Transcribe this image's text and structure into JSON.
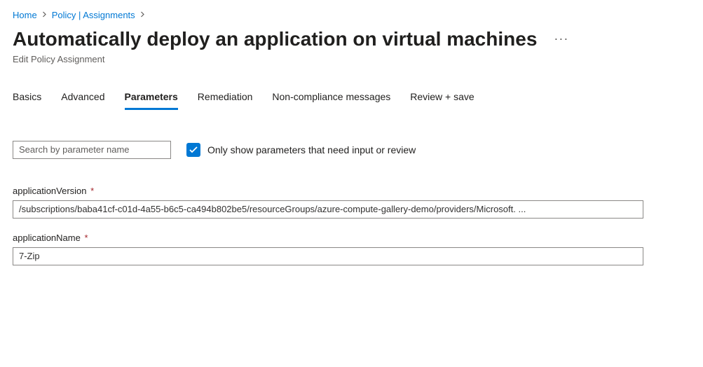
{
  "breadcrumb": {
    "home": "Home",
    "policy": "Policy | Assignments"
  },
  "header": {
    "title": "Automatically deploy an application on virtual machines",
    "subtitle": "Edit Policy Assignment",
    "more": "···"
  },
  "tabs": [
    {
      "label": "Basics",
      "active": false
    },
    {
      "label": "Advanced",
      "active": false
    },
    {
      "label": "Parameters",
      "active": true
    },
    {
      "label": "Remediation",
      "active": false
    },
    {
      "label": "Non-compliance messages",
      "active": false
    },
    {
      "label": "Review + save",
      "active": false
    }
  ],
  "filter": {
    "search_placeholder": "Search by parameter name",
    "only_show_label": "Only show parameters that need input or review",
    "only_show_checked": true
  },
  "parameters": {
    "applicationVersion": {
      "label": "applicationVersion",
      "required": true,
      "value": "/subscriptions/baba41cf-c01d-4a55-b6c5-ca494b802be5/resourceGroups/azure-compute-gallery-demo/providers/Microsoft. ..."
    },
    "applicationName": {
      "label": "applicationName",
      "required": true,
      "value": "7-Zip"
    }
  }
}
